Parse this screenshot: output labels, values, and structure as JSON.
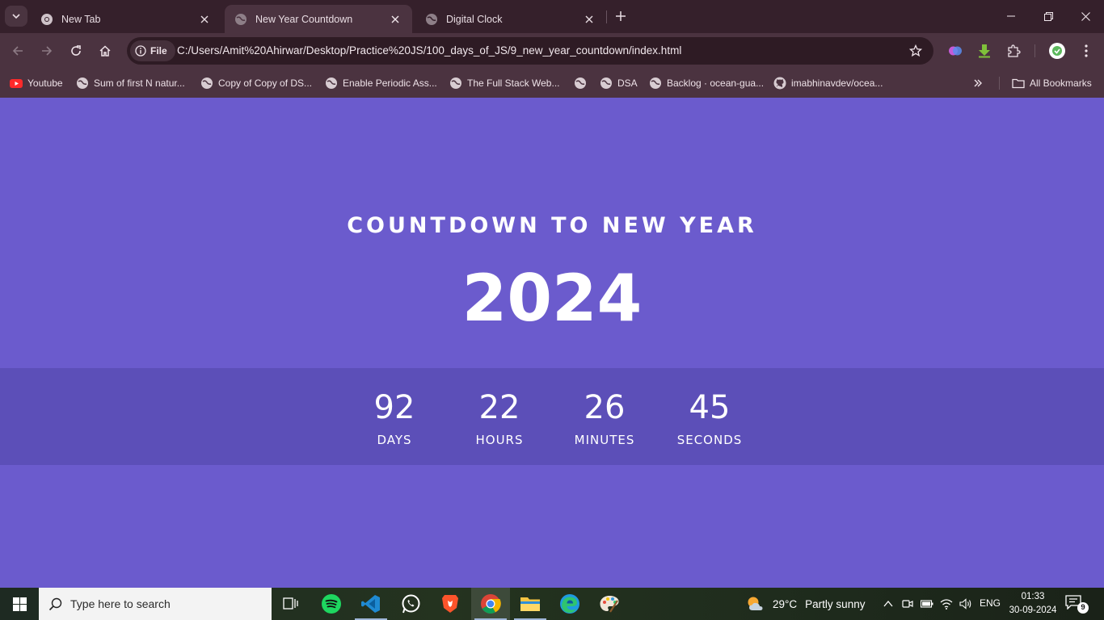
{
  "browser": {
    "tabs": [
      {
        "title": "New Tab",
        "icon": "chrome-icon",
        "active": false
      },
      {
        "title": "New Year Countdown",
        "icon": "globe-icon",
        "active": true
      },
      {
        "title": "Digital Clock",
        "icon": "globe-icon",
        "active": false
      }
    ],
    "omnibox": {
      "scheme_label": "File",
      "url": "C:/Users/Amit%20Ahirwar/Desktop/Practice%20JS/100_days_of_JS/9_new_year_countdown/index.html"
    },
    "bookmarks": [
      {
        "label": "Youtube",
        "icon": "youtube-icon"
      },
      {
        "label": "Sum of first N natur...",
        "icon": "globe-icon"
      },
      {
        "label": "Copy of Copy of DS...",
        "icon": "globe-icon"
      },
      {
        "label": "Enable Periodic Ass...",
        "icon": "globe-icon"
      },
      {
        "label": "The Full Stack Web...",
        "icon": "globe-icon"
      },
      {
        "label": "",
        "icon": "globe-icon"
      },
      {
        "label": "DSA",
        "icon": "globe-icon"
      },
      {
        "label": "Backlog · ocean-gua...",
        "icon": "globe-icon"
      },
      {
        "label": "imabhinavdev/ocea...",
        "icon": "github-icon"
      }
    ],
    "all_bookmarks_label": "All Bookmarks"
  },
  "countdown": {
    "heading": "Countdown to New Year",
    "year": "2024",
    "units": [
      {
        "value": "92",
        "label": "Days"
      },
      {
        "value": "22",
        "label": "Hours"
      },
      {
        "value": "26",
        "label": "Minutes"
      },
      {
        "value": "45",
        "label": "Seconds"
      }
    ]
  },
  "taskbar": {
    "search_placeholder": "Type here to search",
    "weather": {
      "temp": "29°C",
      "condition": "Partly sunny"
    },
    "language": "ENG",
    "time": "01:33",
    "date": "30-09-2024",
    "notification_count": "9"
  },
  "colors": {
    "page_background": "#6b5bcd",
    "countdown_band": "#5c4fb8",
    "browser_frame": "#35202b",
    "toolbar": "#4b3340"
  }
}
